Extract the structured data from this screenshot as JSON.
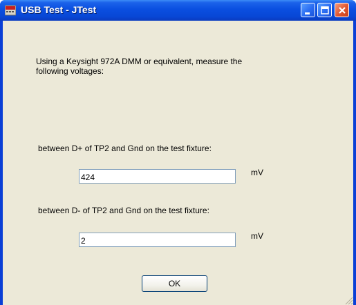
{
  "window": {
    "title": "USB Test - JTest"
  },
  "instructions": {
    "line1": "Using a Keysight 972A DMM or equivalent, measure the",
    "line2": "following voltages:"
  },
  "measurement_dplus": {
    "label": "between D+ of TP2 and Gnd on the test fixture:",
    "value": "424",
    "unit": "mV"
  },
  "measurement_dminus": {
    "label": "between D- of TP2 and Gnd on the test fixture:",
    "value": "2",
    "unit": "mV"
  },
  "ok_button": {
    "label": "OK"
  }
}
